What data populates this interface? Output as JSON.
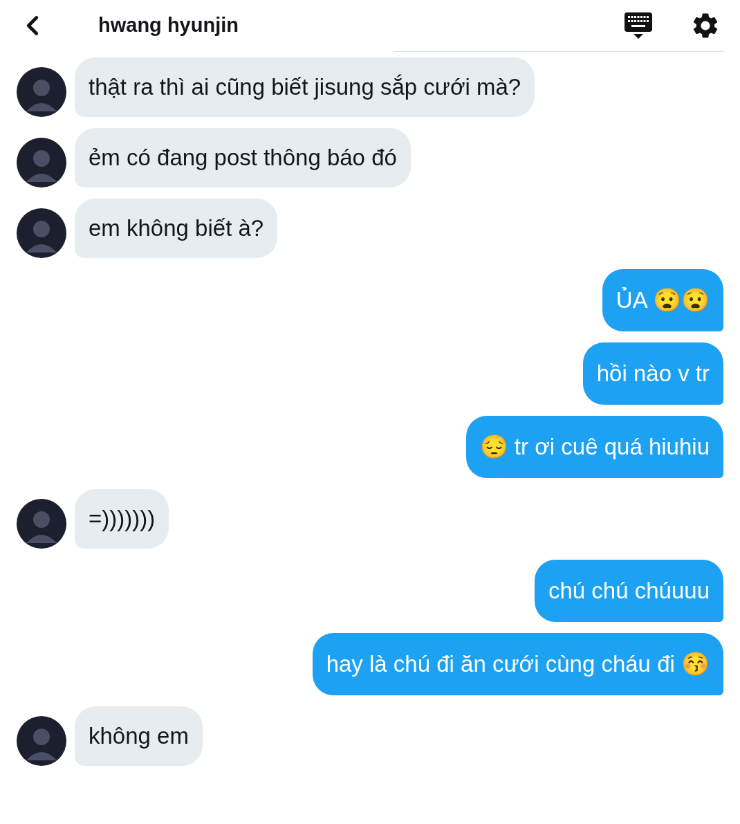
{
  "header": {
    "title": "hwang hyunjin"
  },
  "messages": [
    {
      "kind": "incoming",
      "text": "thật ra thì ai cũng biết jisung sắp cưới mà?"
    },
    {
      "kind": "incoming",
      "text": "ẻm có đang post thông báo đó"
    },
    {
      "kind": "incoming",
      "text": "em không biết à?"
    },
    {
      "kind": "outgoing",
      "text": "ỦA 😧😧"
    },
    {
      "kind": "outgoing",
      "text": "hồi nào v tr"
    },
    {
      "kind": "outgoing",
      "text": "😔 tr ơi cuê quá hiuhiu"
    },
    {
      "kind": "incoming",
      "text": "=)))))))"
    },
    {
      "kind": "outgoing",
      "text": "chú chú chúuuu"
    },
    {
      "kind": "outgoing",
      "text": "hay là chú đi ăn cưới cùng cháu đi 😚"
    },
    {
      "kind": "incoming",
      "text": "không em"
    }
  ]
}
